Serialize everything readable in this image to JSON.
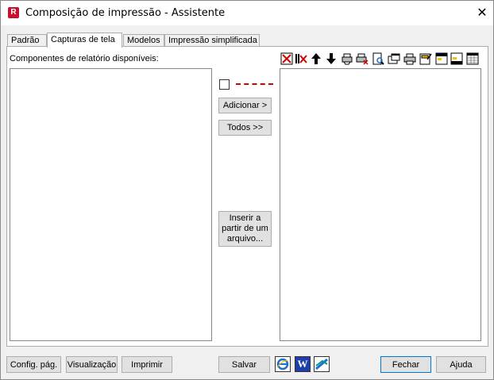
{
  "window": {
    "title": "Composição de impressão - Assistente",
    "app_icon_letter": "R",
    "close_glyph": "✕"
  },
  "tabs": [
    {
      "label": "Padrão",
      "active": false
    },
    {
      "label": "Capturas de tela",
      "active": true
    },
    {
      "label": "Modelos",
      "active": false
    },
    {
      "label": "Impressão simplificada",
      "active": false
    }
  ],
  "panel": {
    "available_label": "Componentes de relatório disponíveis:",
    "add_button": "Adicionar >",
    "all_button": "Todos >>",
    "insert_button_lines": [
      "Inserir a",
      "partir de um",
      "arquivo..."
    ]
  },
  "toolbar_icons": [
    "delete-icon",
    "delete-all-icon",
    "move-up-icon",
    "move-down-icon",
    "print-settings-icon",
    "print-delete-icon",
    "preview-icon",
    "window-icon",
    "printer-icon",
    "edit-header-icon",
    "page-header-icon",
    "page-footer-icon",
    "table-icon"
  ],
  "bottom": {
    "page_setup": "Config. pág.",
    "preview": "Visualização",
    "print": "Imprimir",
    "save": "Salvar",
    "ie_icon": "internet-explorer-icon",
    "word_icon": "word-icon",
    "word_letter": "W",
    "export_icon": "export-icon",
    "close": "Fechar",
    "help": "Ajuda"
  },
  "colors": {
    "accent_red": "#d40000",
    "app_icon_bg": "#c8102e",
    "word_blue": "#1f3fa8",
    "ie_blue": "#1c6fd6"
  }
}
